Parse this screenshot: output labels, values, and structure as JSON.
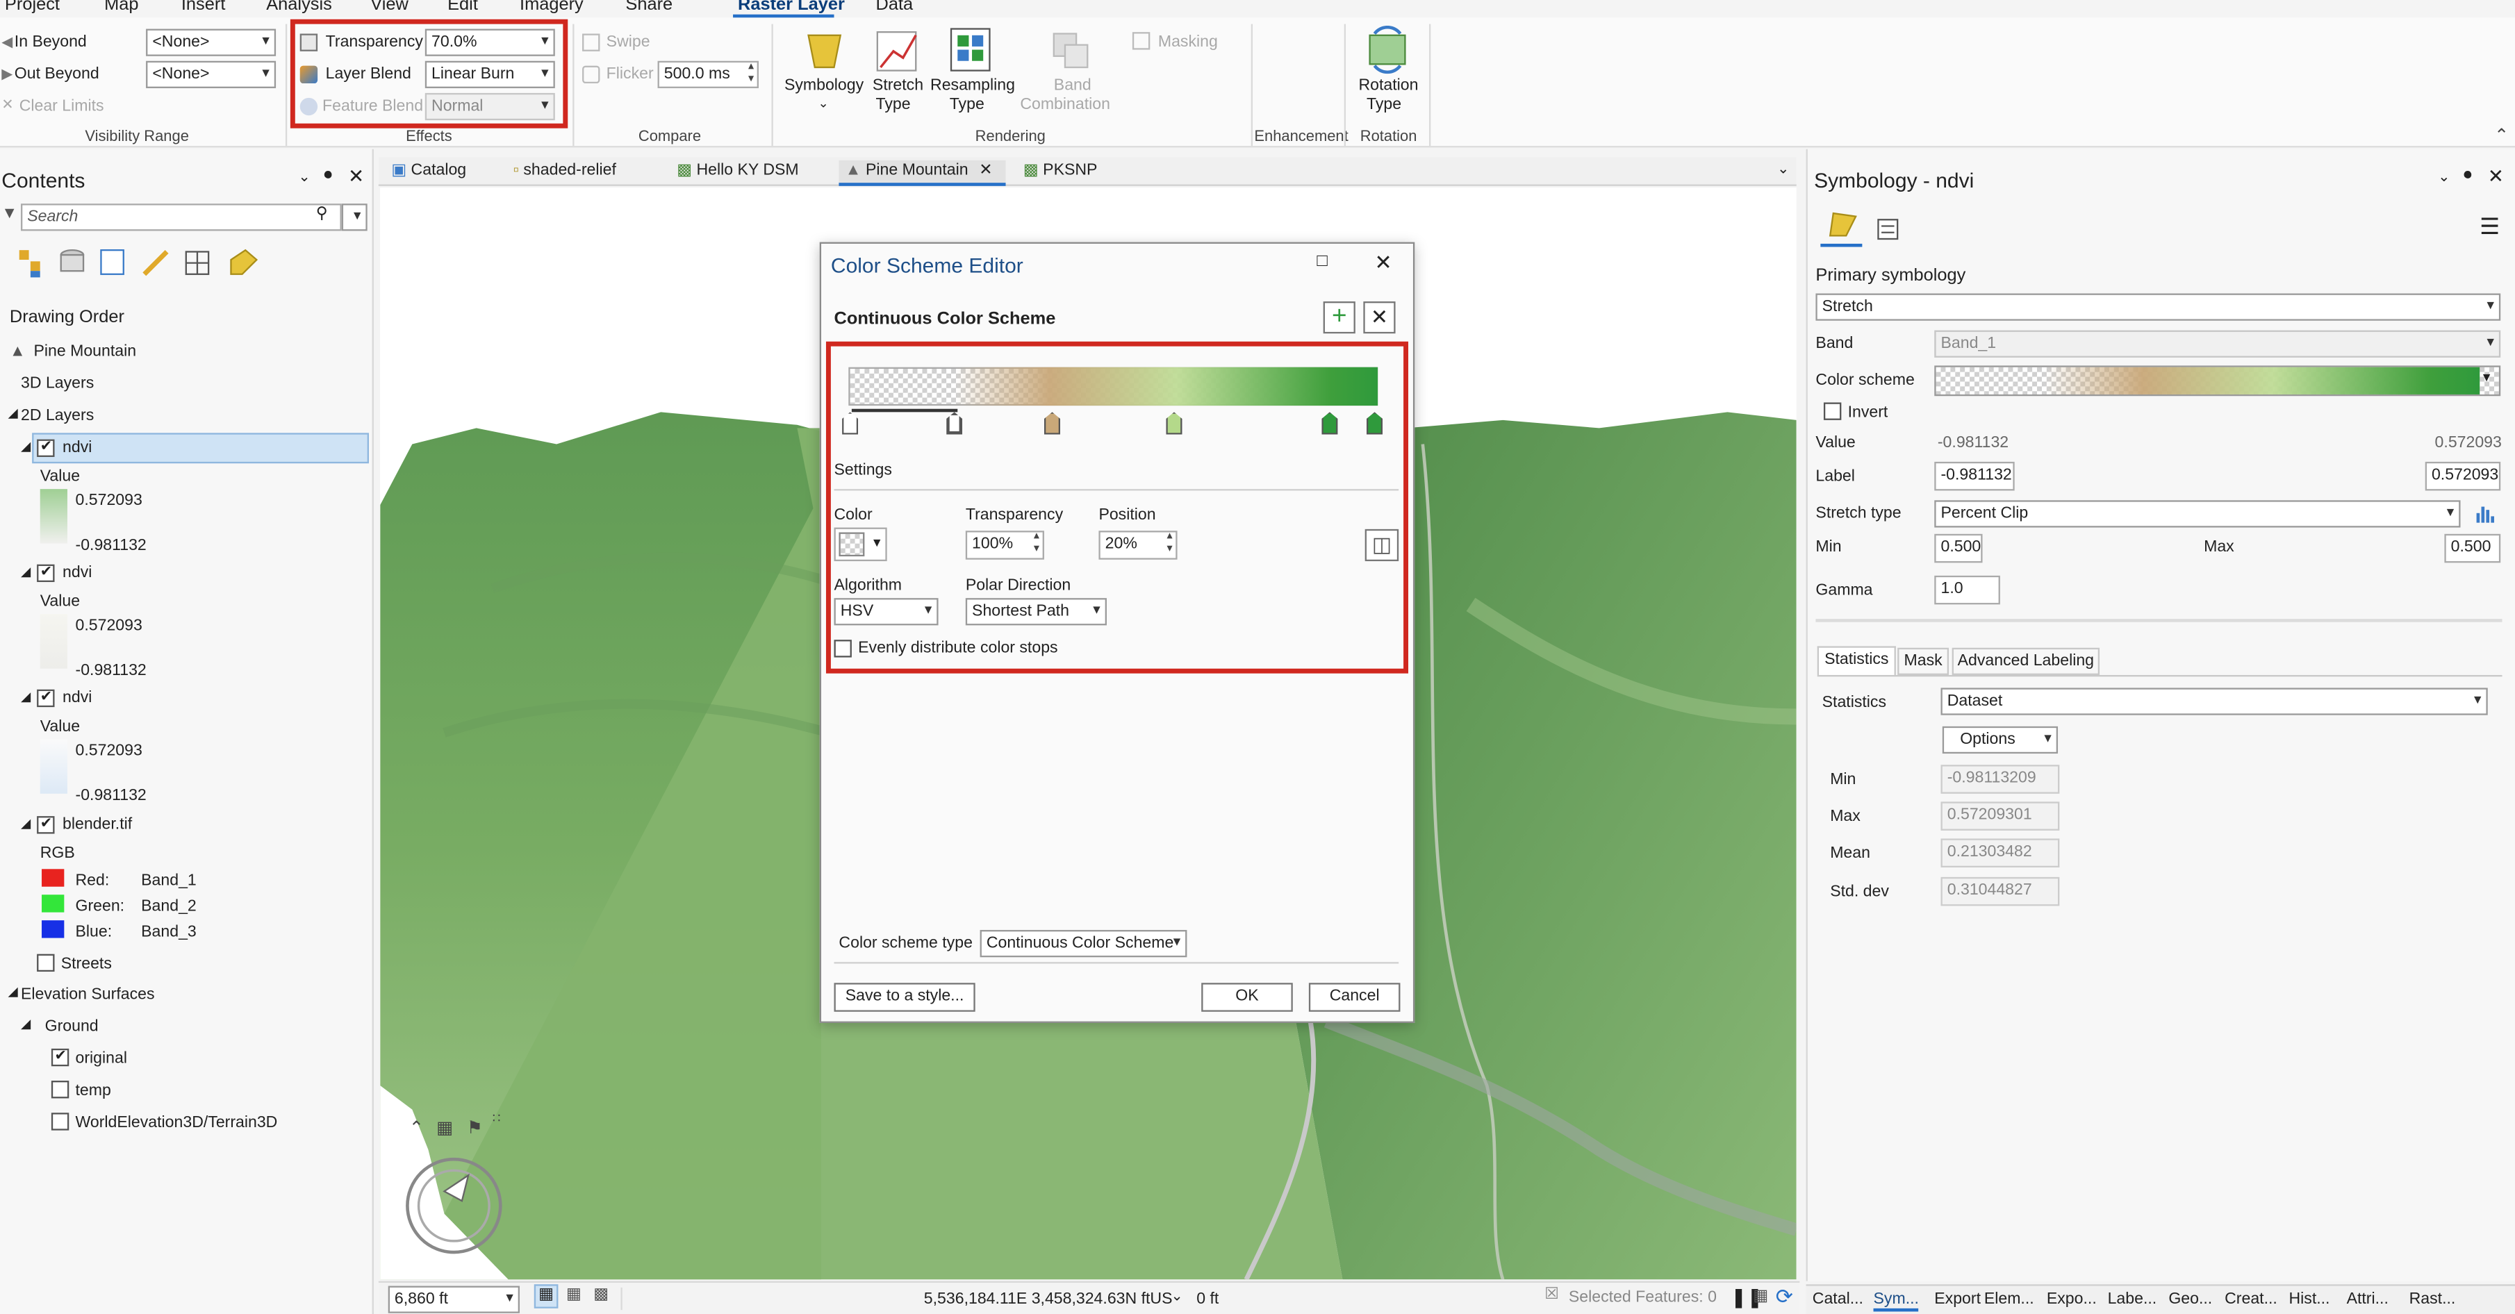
{
  "menu": {
    "items": [
      "Project",
      "Map",
      "Insert",
      "Analysis",
      "View",
      "Edit",
      "Imagery",
      "Share",
      "Raster Layer",
      "Data"
    ]
  },
  "ribbon": {
    "in_beyond": "In Beyond",
    "out_beyond": "Out Beyond",
    "none1": "<None>",
    "none2": "<None>",
    "clear_limits": "Clear Limits",
    "visibility_range": "Visibility Range",
    "transparency_label": "Transparency",
    "transparency_value": "70.0%",
    "layer_blend_label": "Layer Blend",
    "layer_blend_value": "Linear Burn",
    "feature_blend_label": "Feature Blend",
    "feature_blend_value": "Normal",
    "effects": "Effects",
    "swipe": "Swipe",
    "flicker": "Flicker",
    "flicker_value": "500.0  ms",
    "compare": "Compare",
    "symbology": "Symbology",
    "stretch_type_1": "Stretch",
    "stretch_type_2": "Type",
    "resampling_1": "Resampling",
    "resampling_2": "Type",
    "band_1": "Band",
    "band_2": "Combination",
    "masking": "Masking",
    "rendering": "Rendering",
    "enhancement": "Enhancement",
    "rotation_1": "Rotation",
    "rotation_2": "Type",
    "rotation": "Rotation"
  },
  "contents": {
    "title": "Contents",
    "search_placeholder": "Search",
    "drawing_order": "Drawing Order",
    "map_name": "Pine Mountain",
    "layers_3d": "3D Layers",
    "layers_2d": "2D Layers",
    "value": "Value",
    "ndvi": "ndvi",
    "max": "0.572093",
    "min": "-0.981132",
    "blender": "blender.tif",
    "rgb": "RGB",
    "red": "Red:",
    "red_band": "Band_1",
    "green": "Green:",
    "green_band": "Band_2",
    "blue": "Blue:",
    "blue_band": "Band_3",
    "streets": "Streets",
    "elevation": "Elevation Surfaces",
    "ground": "Ground",
    "original": "original",
    "temp": "temp",
    "world": "WorldElevation3D/Terrain3D"
  },
  "tabs": [
    "Catalog",
    "shaded-relief",
    "Hello KY DSM",
    "Pine Mountain",
    "PKSNP"
  ],
  "status": {
    "scale": "6,860 ft",
    "coords": "5,536,184.11E 3,458,324.63N ftUS",
    "elev": "0 ft",
    "selected": "Selected Features: 0"
  },
  "dialog": {
    "title": "Color Scheme Editor",
    "subtitle": "Continuous Color Scheme",
    "settings": "Settings",
    "color": "Color",
    "transparency": "Transparency",
    "transparency_value": "100%",
    "position": "Position",
    "position_value": "20%",
    "algorithm": "Algorithm",
    "algorithm_value": "HSV",
    "polar": "Polar Direction",
    "polar_value": "Shortest Path",
    "evenly": "Evenly distribute color stops",
    "type_label": "Color scheme type",
    "type_value": "Continuous Color Scheme",
    "save": "Save to a style...",
    "ok": "OK",
    "cancel": "Cancel"
  },
  "symbology": {
    "title": "Symbology - ndvi",
    "primary": "Primary symbology",
    "stretch": "Stretch",
    "band": "Band",
    "band_value": "Band_1",
    "color_scheme": "Color scheme",
    "invert": "Invert",
    "value": "Value",
    "value_min": "-0.981132",
    "value_max": "0.572093",
    "label": "Label",
    "label_min": "-0.981132",
    "label_max": "0.572093",
    "stretch_type": "Stretch type",
    "stretch_type_value": "Percent Clip",
    "min": "Min",
    "min_value": "0.500",
    "max": "Max",
    "max_value": "0.500",
    "gamma": "Gamma",
    "gamma_value": "1.0",
    "tab_statistics": "Statistics",
    "tab_mask": "Mask",
    "tab_labeling": "Advanced Labeling",
    "statistics": "Statistics",
    "statistics_value": "Dataset",
    "options": "Options",
    "stat_min": "Min",
    "stat_min_v": "-0.98113209",
    "stat_max": "Max",
    "stat_max_v": "0.57209301",
    "stat_mean": "Mean",
    "stat_mean_v": "0.21303482",
    "stat_std": "Std. dev",
    "stat_std_v": "0.31044827"
  },
  "bottom_tabs": [
    "Catal...",
    "Sym...",
    "Export",
    "Elem...",
    "Expo...",
    "Labe...",
    "Geo...",
    "Creat...",
    "Hist...",
    "Attri...",
    "Rast..."
  ],
  "colors": {
    "accent": "#2670c8",
    "highlight": "#d0281f",
    "green": "#2f9a3c"
  }
}
